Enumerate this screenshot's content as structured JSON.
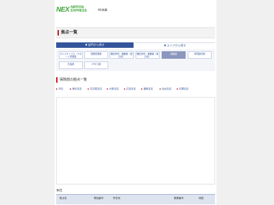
{
  "header": {
    "logo_mark": "NEX",
    "logo_line1": "NIPPON",
    "logo_line2": "EXPRESS",
    "logo_sub": "NX商事"
  },
  "page_title": "拠点一覧",
  "tabs": [
    {
      "label": "▼ 部門から探す"
    },
    {
      "label": "▼ エリアから探す"
    }
  ],
  "departments": [
    {
      "label": "ロジスティクス・サポート事業部"
    },
    {
      "label": "国際営業部"
    },
    {
      "label": "梱包資材・機器部（西日本）"
    },
    {
      "label": "梱包資材・機器部（東日本）"
    },
    {
      "label": "保険部"
    },
    {
      "label": "環境製作部"
    },
    {
      "label": "石油部"
    },
    {
      "label": "LPガス部"
    }
  ],
  "section": {
    "title": "保険部の拠点一覧",
    "links": [
      "本社",
      "東京支店",
      "名古屋支店",
      "大阪支店",
      "広島支店",
      "福岡支店",
      "仙台支店",
      "札幌支店"
    ]
  },
  "table": {
    "section_label": "本社",
    "headers": [
      "拠点名",
      "電話番号",
      "所在地",
      "郵便番号",
      "地図"
    ]
  }
}
